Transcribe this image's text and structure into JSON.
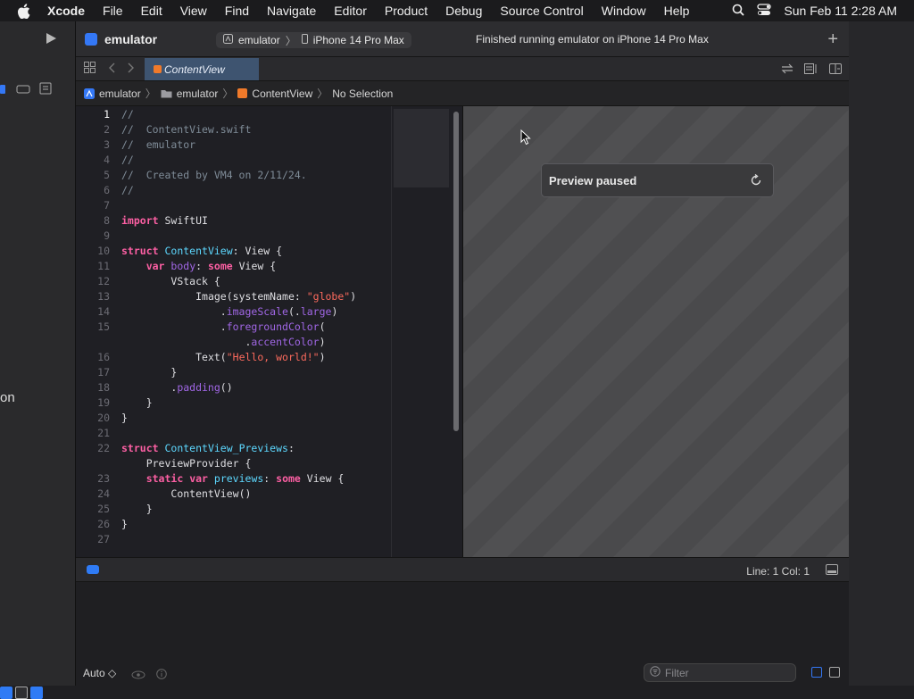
{
  "menubar": {
    "app": "Xcode",
    "items": [
      "File",
      "Edit",
      "View",
      "Find",
      "Navigate",
      "Editor",
      "Product",
      "Debug",
      "Source Control",
      "Window",
      "Help"
    ],
    "datetime": "Sun Feb 11  2:28 AM"
  },
  "leftstrip": {
    "partial_text": "on"
  },
  "titlebar": {
    "project": "emulator",
    "scheme": "emulator",
    "destination": "iPhone 14 Pro Max",
    "status": "Finished running emulator on iPhone 14 Pro Max"
  },
  "tab": {
    "label": "ContentView"
  },
  "breadcrumb": {
    "items": [
      "emulator",
      "emulator",
      "ContentView",
      "No Selection"
    ]
  },
  "code": {
    "lines": [
      {
        "n": "1",
        "active": true,
        "html": "<span class='cm'>//</span>"
      },
      {
        "n": "2",
        "html": "<span class='cm'>//  ContentView.swift</span>"
      },
      {
        "n": "3",
        "html": "<span class='cm'>//  emulator</span>"
      },
      {
        "n": "4",
        "html": "<span class='cm'>//</span>"
      },
      {
        "n": "5",
        "html": "<span class='cm'>//  Created by VM4 on 2/11/24.</span>"
      },
      {
        "n": "6",
        "html": "<span class='cm'>//</span>"
      },
      {
        "n": "7",
        "html": ""
      },
      {
        "n": "8",
        "html": "<span class='kw'>import</span> <span class='pl'>SwiftUI</span>"
      },
      {
        "n": "9",
        "html": ""
      },
      {
        "n": "10",
        "html": "<span class='kw'>struct</span> <span class='ty'>ContentView</span>: <span class='pl'>View</span> {"
      },
      {
        "n": "11",
        "html": "    <span class='kw'>var</span> <span class='fn'>body</span>: <span class='kw'>some</span> <span class='pl'>View</span> {"
      },
      {
        "n": "12",
        "html": "        <span class='pl'>VStack</span> {"
      },
      {
        "n": "13",
        "html": "            <span class='pl'>Image</span>(systemName: <span class='st'>\"globe\"</span>)"
      },
      {
        "n": "14",
        "html": "                .<span class='fn'>imageScale</span>(.<span class='fn'>large</span>)"
      },
      {
        "n": "15",
        "html": "                .<span class='fn'>foregroundColor</span>("
      },
      {
        "n": "",
        "html": "                    .<span class='fn'>accentColor</span>)"
      },
      {
        "n": "16",
        "html": "            <span class='pl'>Text</span>(<span class='st'>\"Hello, world!\"</span>)"
      },
      {
        "n": "17",
        "html": "        }"
      },
      {
        "n": "18",
        "html": "        .<span class='fn'>padding</span>()"
      },
      {
        "n": "19",
        "html": "    }"
      },
      {
        "n": "20",
        "html": "}"
      },
      {
        "n": "21",
        "html": ""
      },
      {
        "n": "22",
        "html": "<span class='kw'>struct</span> <span class='ty'>ContentView_Previews</span>:"
      },
      {
        "n": "",
        "html": "    <span class='pl'>PreviewProvider</span> {"
      },
      {
        "n": "23",
        "html": "    <span class='kw'>static</span> <span class='kw'>var</span> <span class='ty'>previews</span>: <span class='kw'>some</span> <span class='pl'>View</span> {"
      },
      {
        "n": "24",
        "html": "        <span class='pl'>ContentView</span>()"
      },
      {
        "n": "25",
        "html": "    }"
      },
      {
        "n": "26",
        "html": "}"
      },
      {
        "n": "27",
        "html": ""
      }
    ]
  },
  "preview": {
    "status": "Preview paused"
  },
  "debugbar": {
    "position": "Line: 1  Col: 1"
  },
  "console": {
    "mode": "Auto ◇",
    "filter_placeholder": "Filter"
  },
  "colors": {
    "accent": "#3478f6",
    "tab_bg": "#3e5470",
    "swift_orange": "#f07a2a"
  }
}
